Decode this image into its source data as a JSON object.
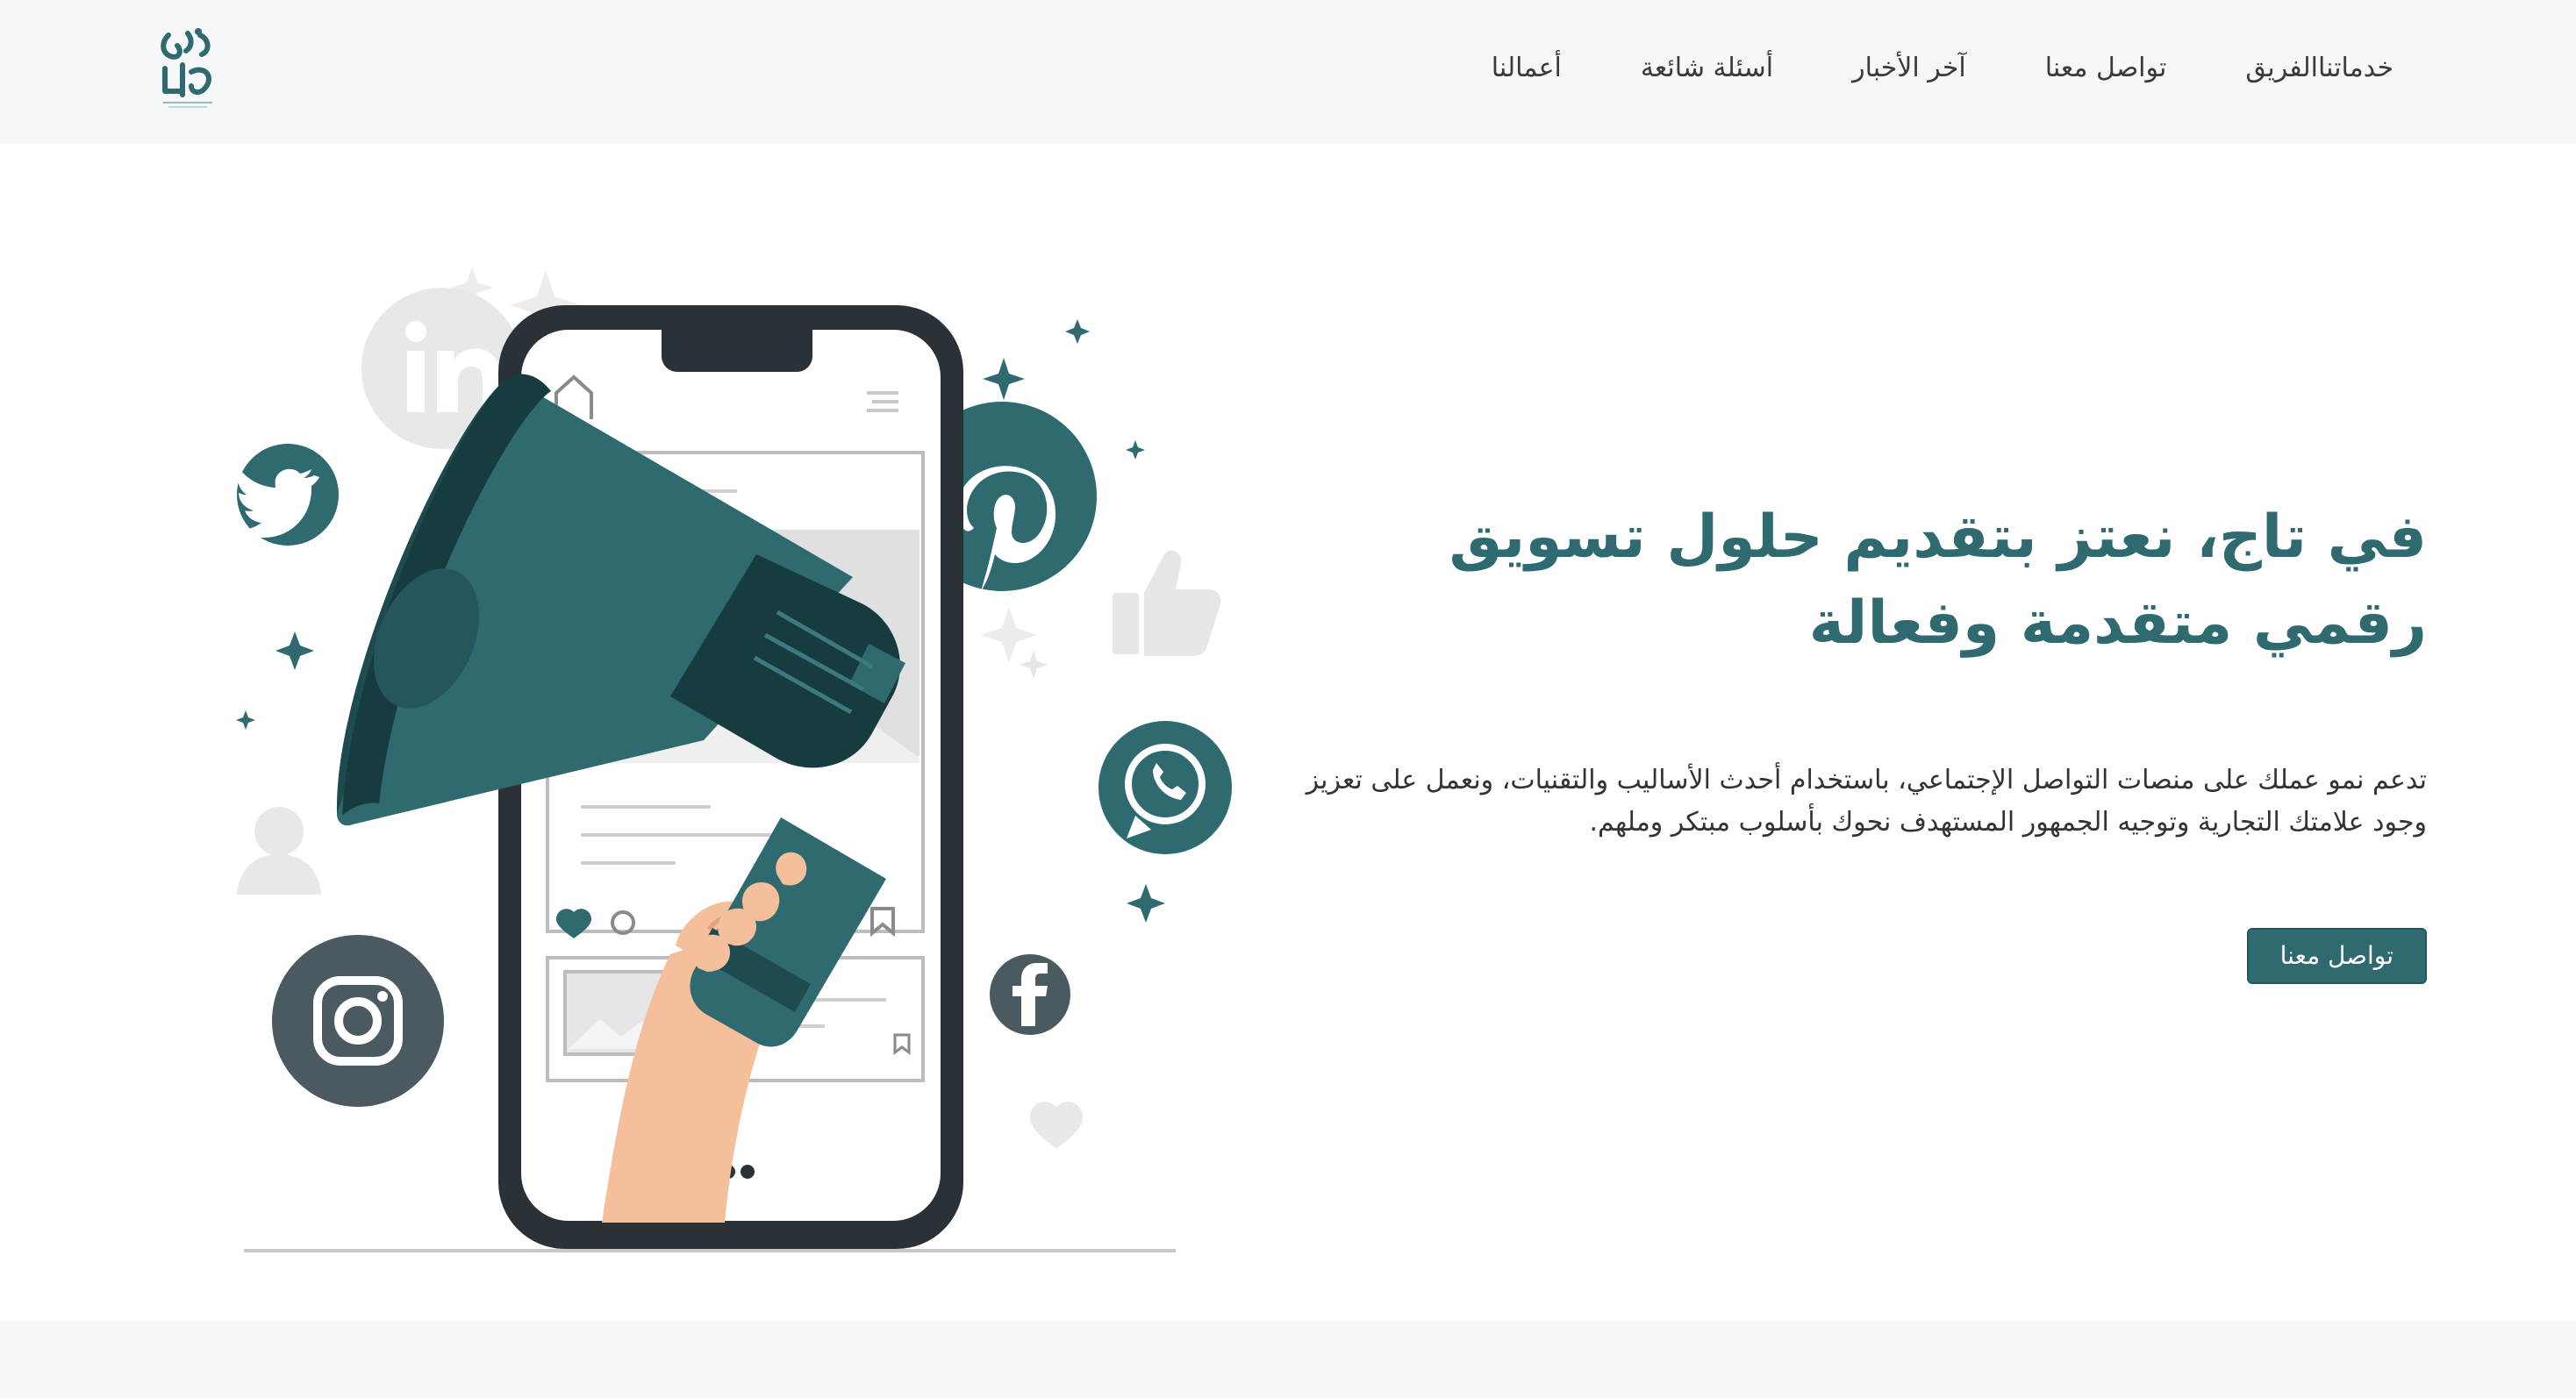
{
  "nav": {
    "items": [
      {
        "label": "خدماتنا"
      },
      {
        "label": "الفريق"
      },
      {
        "label": "تواصل معنا"
      },
      {
        "label": "آخر الأخبار"
      },
      {
        "label": "أسئلة شائعة"
      },
      {
        "label": "أعمالنا"
      }
    ]
  },
  "hero": {
    "title_line1": "في تاج، نعتز بتقديم حلول تسويق",
    "title_line2": "رقمي متقدمة وفعالة",
    "description": "تدعم نمو عملك على منصات التواصل الإجتماعي، باستخدام أحدث الأساليب والتقنيات، ونعمل على تعزيز وجود علامتك التجارية وتوجيه الجمهور المستهدف نحوك بأسلوب مبتكر وملهم.",
    "cta_label": "تواصل معنا"
  },
  "colors": {
    "brand": "#2e6a70",
    "brand_dark": "#1f4a4f",
    "nav_bg": "#f6f7f9",
    "phone_frame": "#2b3237",
    "skin": "#f5bf9b",
    "light_gray": "#e4e4e4"
  },
  "illustration": {
    "icons": [
      "linkedin-icon",
      "twitter-icon",
      "pinterest-icon",
      "whatsapp-icon",
      "facebook-icon",
      "instagram-icon",
      "thumbs-up-icon",
      "user-icon",
      "heart-icon",
      "megaphone-icon",
      "phone-icon",
      "hand-icon",
      "sparkle-icon"
    ]
  }
}
